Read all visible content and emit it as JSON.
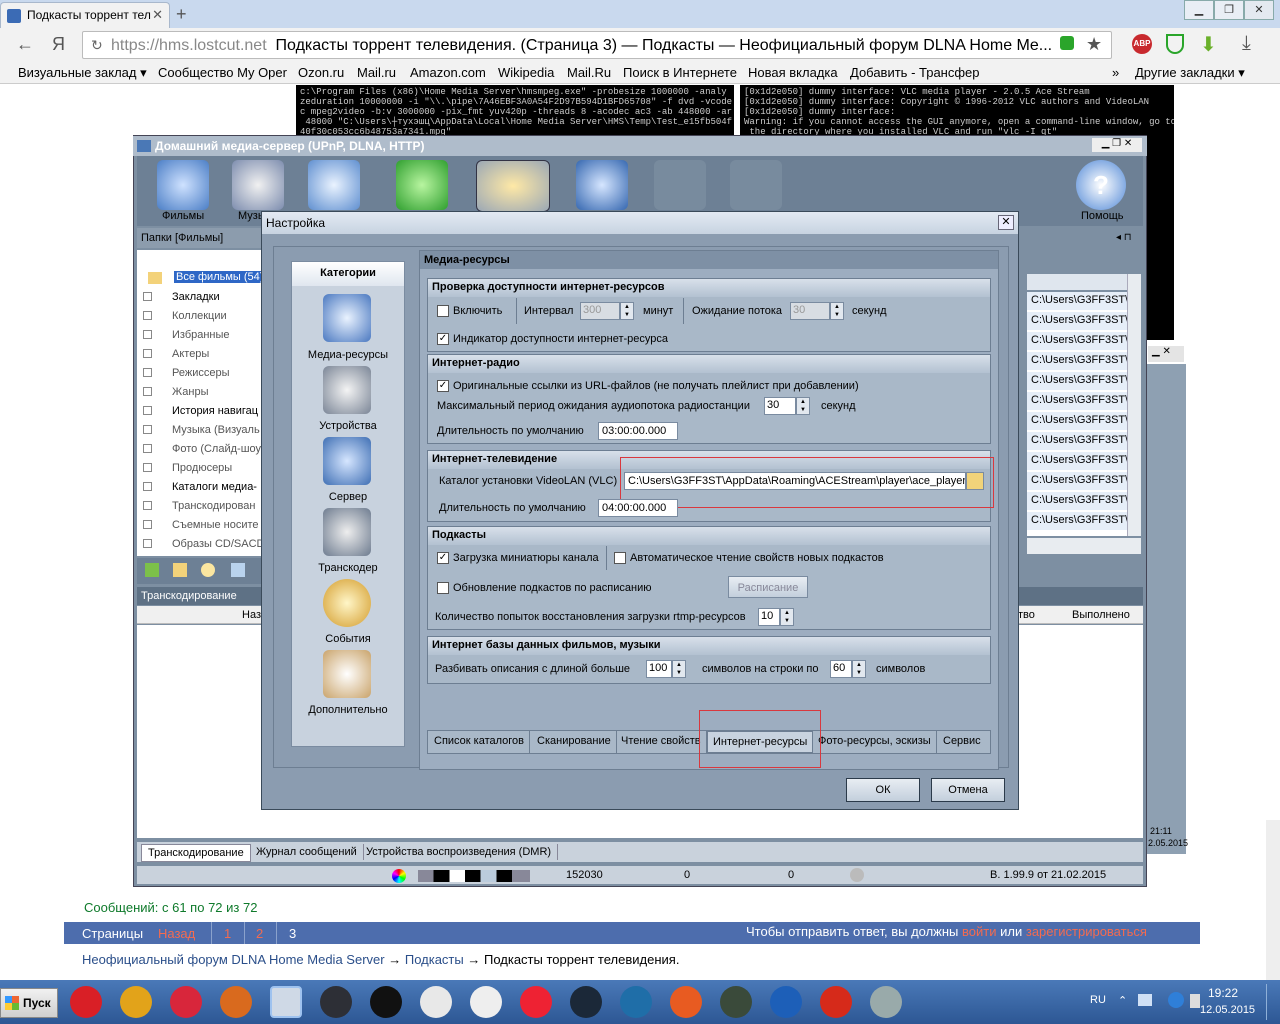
{
  "browser": {
    "tab_title": "Подкасты торрент тел",
    "url_protocol": "https://",
    "url_host": "hms.lostcut.net",
    "url_title": "Подкасты торрент телевидения. (Страница 3) — Подкасты — Неофициальный форум DLNA Home Me...",
    "bookmarks": [
      "Визуальные заклад ▾",
      "Сообщество My Oper",
      "Ozon.ru",
      "Mail.ru",
      "Amazon.com",
      "Wikipedia",
      "Mail.Ru",
      "Поиск в Интернете",
      "Новая вкладка",
      "Добавить - Трансфер",
      "»",
      "Другие закладки ▾"
    ]
  },
  "terminal": {
    "left_lines": [
      "c:\\Program Files (x86)\\Home Media Server\\hmsmpeg.exe\" -probesize 1000000 -analy",
      "zeduration 10000000 -i \"\\\\.\\pipe\\7A46EBF3A0A54F2D97B594D1BFD65708\" -f dvd -vcode",
      "c mpeg2video -b:v 3000000 -pix_fmt yuv420p -threads 8 -acodec ac3 -ab 448000 -ar",
      " 48000 \"C:\\Users\\┼тухэшц\\AppData\\Local\\Home Media Server\\HMS\\Temp\\Test_e15fb504f",
      "40f30c053cc6b48753a7341.mpg\""
    ],
    "right_lines": [
      "[0x1d2e050] dummy interface: VLC media player - 2.0.5 Ace Stream",
      "[0x1d2e050] dummy interface: Copyright © 1996-2012 VLC authors and VideoLAN",
      "[0x1d2e050] dummy interface:",
      "Warning: if you cannot access the GUI anymore, open a command-line window, go to",
      " the directory where you installed VLC and run \"vlc -I qt\""
    ]
  },
  "hms": {
    "title": "Домашний медиа-сервер (UPnP, DLNA, HTTP)",
    "toolbar": [
      "Фильмы",
      "Музы",
      "Помощь"
    ],
    "folders_header": "Папки [Фильмы]",
    "tree": [
      "Все фильмы (54)",
      "Закладки",
      "Коллекции",
      "Избранные",
      "Актеры",
      "Режиссеры",
      "Жанры",
      "История навигац",
      "Музыка (Визуаль",
      "Фото (Слайд-шоу",
      "Продюсеры",
      "Каталоги медиа-",
      "Транскодирован",
      "Съемные носите",
      "Образы CD/SACD"
    ],
    "right_list_item": "C:\\Users\\G3FF3ST\\",
    "right_list_count": 12,
    "transcoding_header": "Транскодирование",
    "col_name": "Наз",
    "col_status": "тво",
    "col_done": "Выполнено",
    "bottom_tabs": [
      "Транскодирование",
      "Журнал сообщений",
      "Устройства воспроизведения (DMR)"
    ],
    "status": {
      "count1": "152030",
      "count2": "0",
      "count3": "0",
      "version": "В. 1.99.9 от 21.02.2015"
    },
    "side_time": "21:11",
    "side_date": "2.05.2015"
  },
  "dialog": {
    "title": "Настройка",
    "categories_header": "Категории",
    "categories": [
      "Медиа-ресурсы",
      "Устройства",
      "Сервер",
      "Транскодер",
      "События",
      "Дополнительно"
    ],
    "panel_title": "Медиа-ресурсы",
    "availability": {
      "header": "Проверка доступности интернет-ресурсов",
      "enable": "Включить",
      "interval": "Интервал",
      "interval_value": "300",
      "minutes": "минут",
      "wait": "Ожидание потока",
      "wait_value": "30",
      "seconds": "секунд",
      "indicator": "Индикатор доступности интернет-ресурса"
    },
    "radio": {
      "header": "Интернет-радио",
      "original_links": "Оригинальные ссылки из URL-файлов (не получать плейлист при добавлении)",
      "max_wait": "Максимальный период ожидания аудиопотока  радиостанции",
      "max_wait_value": "30",
      "seconds": "секунд",
      "duration": "Длительность по умолчанию",
      "duration_value": "03:00:00.000"
    },
    "tv": {
      "header": "Интернет-телевидение",
      "vlc_dir": "Каталог установки VideoLAN (VLC)",
      "vlc_path": "C:\\Users\\G3FF3ST\\AppData\\Roaming\\ACEStream\\player\\ace_player.e",
      "duration": "Длительность по умолчанию",
      "duration_value": "04:00:00.000"
    },
    "podcasts": {
      "header": "Подкасты",
      "thumbs": "Загрузка миниатюры канала",
      "auto_read": "Автоматическое чтение свойств новых подкастов",
      "schedule_update": "Обновление подкастов по расписанию",
      "schedule_btn": "Расписание",
      "rtmp_attempts": "Количество попыток восстановления загрузки rtmp-ресурсов",
      "rtmp_value": "10"
    },
    "db": {
      "header": "Интернет базы данных фильмов, музыки",
      "split": "Разбивать описания с длиной больше",
      "split_value": "100",
      "lines_by": "символов на строки по",
      "lines_value": "60",
      "chars": "символов"
    },
    "tabs": [
      "Список каталогов",
      "Сканирование",
      "Чтение свойств",
      "Интернет-ресурсы",
      "Фото-ресурсы, эскизы",
      "Сервис"
    ],
    "ok": "ОК",
    "cancel": "Отмена"
  },
  "forum": {
    "messages": "Сообщений: с 61 по 72 из 72",
    "pages_label": "Страницы",
    "back": "Назад",
    "pages": [
      "1",
      "2",
      "3"
    ],
    "reply_prefix": "Чтобы отправить ответ, вы должны",
    "login": "войти",
    "or": "или",
    "register": "зарегистрироваться",
    "crumb_forum": "Неофициальный форум DLNA Home Media Server",
    "arrow": "→",
    "crumb_section": "Подкасты",
    "crumb_topic": "Подкасты торрент телевидения."
  },
  "taskbar": {
    "start": "Пуск",
    "lang": "RU",
    "time": "19:22",
    "date": "12.05.2015",
    "icons": [
      "opera-icon",
      "chrome-icon",
      "yandex-icon",
      "firefox-icon",
      "hms-icon",
      "app-icon",
      "ctf-icon",
      "proxy-icon",
      "app4-icon",
      "app5-icon",
      "steam-icon",
      "steam2-icon",
      "origin-icon",
      "steam3-icon",
      "ccleaner-icon",
      "ccleaner2-icon",
      "app-circle-icon"
    ]
  },
  "colors": {
    "accent": "#4d6dad",
    "dialog_bg": "#8b9cb0",
    "red_highlight": "#d9383e",
    "forum_green": "#0f7a2b"
  }
}
